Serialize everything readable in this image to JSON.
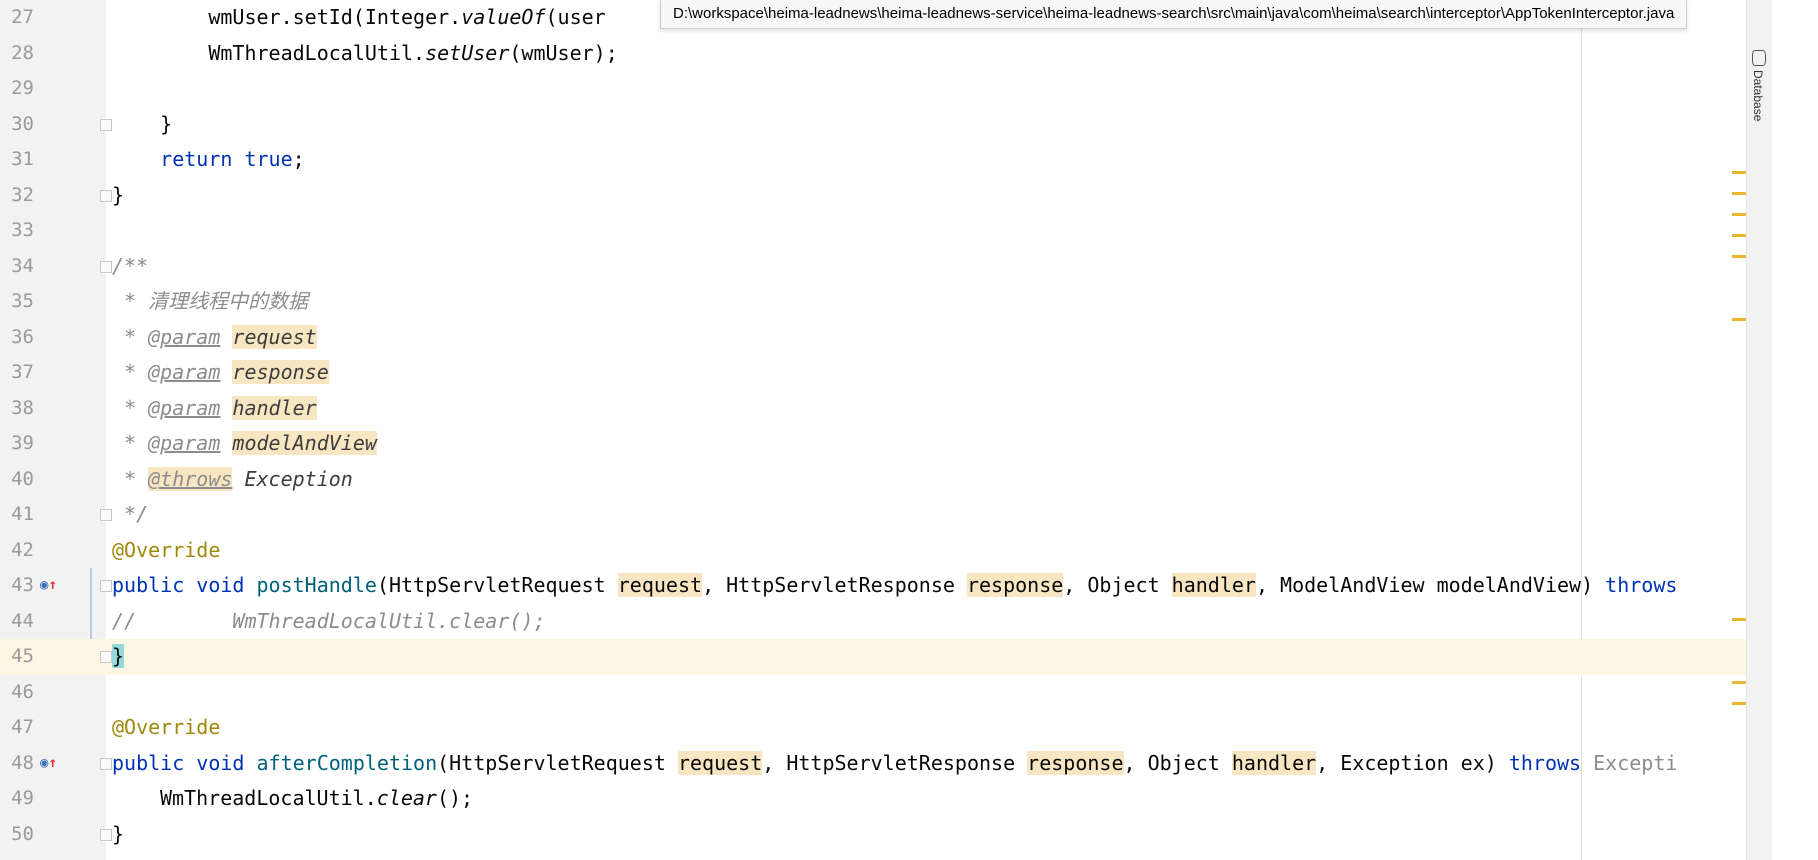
{
  "tooltip": {
    "path": "D:\\workspace\\heima-leadnews\\heima-leadnews-service\\heima-leadnews-search\\src\\main\\java\\com\\heima\\search\\interceptor\\AppTokenInterceptor.java"
  },
  "right_panel": {
    "database_label": "Database"
  },
  "editor": {
    "lines": [
      {
        "n": "27",
        "t1": "        wmUser.setId(Integer.",
        "t2": "valueOf",
        "t3": "(user"
      },
      {
        "n": "28",
        "t1": "        WmThreadLocalUtil.",
        "t2": "setUser",
        "t3": "(wmUser);"
      },
      {
        "n": "29"
      },
      {
        "n": "30",
        "t1": "    }"
      },
      {
        "n": "31",
        "t1": "    ",
        "t2": "return",
        "t3": " ",
        "t4": "true",
        ";": ";"
      },
      {
        "n": "32",
        "t1": "}"
      },
      {
        "n": "33"
      },
      {
        "n": "34",
        "t1": "/**"
      },
      {
        "n": "35",
        "t1": " * 清理线程中的数据"
      },
      {
        "n": "36",
        "star": " * ",
        "tag": "@param",
        "name": "request"
      },
      {
        "n": "37",
        "star": " * ",
        "tag": "@param",
        "name": "response"
      },
      {
        "n": "38",
        "star": " * ",
        "tag": "@param",
        "name": "handler"
      },
      {
        "n": "39",
        "star": " * ",
        "tag": "@param",
        "name": "modelAndView"
      },
      {
        "n": "40",
        "star": " * ",
        "tag": "@throws",
        "name": "Exception"
      },
      {
        "n": "41",
        "t1": " */"
      },
      {
        "n": "42",
        "t1": "@Override"
      },
      {
        "n": "43",
        "kw1": "public",
        "kw2": "void",
        "method": "postHandle",
        "p1": "(HttpServletRequest ",
        "h1": "request",
        "p2": ", HttpServletResponse ",
        "h2": "response",
        "p3": ", Object ",
        "h3": "handler",
        "p4": ", ModelAndView modelAndView) ",
        "kw3": "throws"
      },
      {
        "n": "44",
        "c1": "//",
        "c2": "WmThreadLocalUtil.clear();"
      },
      {
        "n": "45",
        "t1": "}"
      },
      {
        "n": "46"
      },
      {
        "n": "47",
        "t1": "@Override"
      },
      {
        "n": "48",
        "kw1": "public",
        "kw2": "void",
        "method": "afterCompletion",
        "p1": "(HttpServletRequest ",
        "h1": "request",
        "p2": ", HttpServletResponse ",
        "h2": "response",
        "p3": ", Object ",
        "h3": "handler",
        "p4": ", Exception ex) ",
        "kw3": "throws",
        "tail": " Excepti"
      },
      {
        "n": "49",
        "t1": "WmThreadLocalUtil.",
        "t2": "clear",
        "t3": "();"
      },
      {
        "n": "50",
        "t1": "}"
      }
    ]
  },
  "colors": {
    "keyword": "#0033b3",
    "annotation": "#9e880d",
    "method": "#00627a",
    "highlight": "#f8e6c2",
    "current_line": "#fdf6e3"
  }
}
